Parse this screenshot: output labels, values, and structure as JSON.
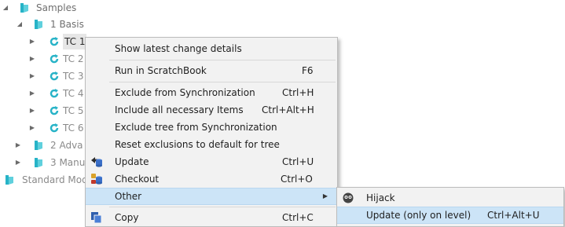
{
  "tree": {
    "root": "Samples",
    "basis": "1 Basis",
    "tc_items": [
      "TC 1",
      "TC 2",
      "TC 3",
      "TC 4",
      "TC 5",
      "TC 6"
    ],
    "advanced": "2 Adva",
    "manual": "3 Manu",
    "standard": "Standard Mod"
  },
  "context_menu": {
    "items": [
      {
        "label": "Show latest change details",
        "shortcut": ""
      },
      {
        "label": "Run in ScratchBook",
        "shortcut": "F6"
      },
      {
        "label": "Exclude from Synchronization",
        "shortcut": "Ctrl+H"
      },
      {
        "label": "Include all necessary Items",
        "shortcut": "Ctrl+Alt+H"
      },
      {
        "label": "Exclude tree from Synchronization",
        "shortcut": ""
      },
      {
        "label": "Reset exclusions to default for tree",
        "shortcut": ""
      },
      {
        "label": "Update",
        "shortcut": "Ctrl+U"
      },
      {
        "label": "Checkout",
        "shortcut": "Ctrl+O"
      },
      {
        "label": "Other",
        "shortcut": ""
      },
      {
        "label": "Copy",
        "shortcut": "Ctrl+C"
      }
    ]
  },
  "submenu": {
    "items": [
      {
        "label": "Hijack",
        "shortcut": ""
      },
      {
        "label": "Update (only on level)",
        "shortcut": "Ctrl+Alt+U"
      }
    ]
  },
  "colors": {
    "accent_teal": "#27b3c7",
    "highlight": "#cce4f7",
    "menu_bg": "#f2f2f2"
  }
}
